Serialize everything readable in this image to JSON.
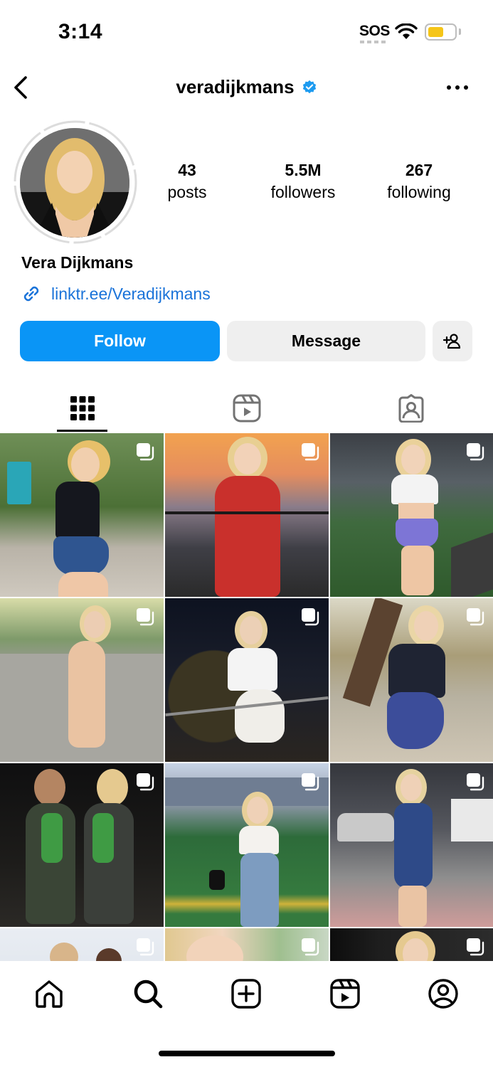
{
  "status_bar": {
    "time": "3:14",
    "sos": "SOS",
    "battery_level": 0.55,
    "battery_color": "#f5c518"
  },
  "header": {
    "username": "veradijkmans",
    "verified": true,
    "back_icon": "chevron-left-icon",
    "more_icon": "more-horizontal-icon"
  },
  "profile": {
    "display_name": "Vera Dijkmans",
    "link": "linktr.ee/Veradijkmans",
    "stats": {
      "posts": {
        "value": "43",
        "label": "posts"
      },
      "followers": {
        "value": "5.5M",
        "label": "followers"
      },
      "following": {
        "value": "267",
        "label": "following"
      }
    }
  },
  "actions": {
    "follow_label": "Follow",
    "message_label": "Message",
    "follow_color": "#0a95f6"
  },
  "tabs": [
    {
      "icon": "grid-icon",
      "active": true
    },
    {
      "icon": "reels-icon",
      "active": false
    },
    {
      "icon": "tagged-icon",
      "active": false
    }
  ],
  "posts": [
    {
      "icon": "multi-photo-icon"
    },
    {
      "icon": "multi-photo-icon"
    },
    {
      "icon": "multi-photo-icon"
    },
    {
      "icon": "multi-photo-icon"
    },
    {
      "icon": "multi-photo-icon"
    },
    {
      "icon": "multi-photo-icon"
    },
    {
      "icon": "multi-photo-icon"
    },
    {
      "icon": "multi-photo-icon"
    },
    {
      "icon": "multi-photo-icon"
    },
    {
      "icon": "multi-photo-icon"
    },
    {
      "icon": "multi-photo-icon"
    },
    {
      "icon": "multi-photo-icon"
    }
  ],
  "bottom_nav": [
    {
      "icon": "home-icon"
    },
    {
      "icon": "search-icon",
      "active": true
    },
    {
      "icon": "create-icon"
    },
    {
      "icon": "reels-icon"
    },
    {
      "icon": "profile-icon"
    }
  ]
}
